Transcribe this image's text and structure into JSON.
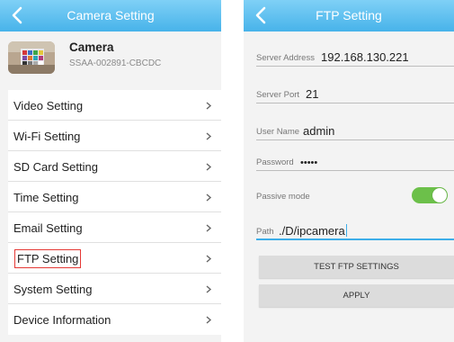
{
  "left": {
    "title": "Camera Setting",
    "camera_name": "Camera",
    "camera_id": "SSAA-002891-CBCDC",
    "menu": [
      {
        "label": "Video Setting"
      },
      {
        "label": "Wi-Fi Setting"
      },
      {
        "label": "SD Card Setting"
      },
      {
        "label": "Time Setting"
      },
      {
        "label": "Email Setting"
      },
      {
        "label": "FTP Setting"
      },
      {
        "label": "System Setting"
      },
      {
        "label": "Device Information"
      }
    ]
  },
  "right": {
    "title": "FTP Setting",
    "server_address": {
      "label": "Server Address",
      "value": "192.168.130.221"
    },
    "server_port": {
      "label": "Server Port",
      "value": "21"
    },
    "user_name": {
      "label": "User Name",
      "value": "admin"
    },
    "password": {
      "label": "Password",
      "value": "•••••"
    },
    "passive_mode": {
      "label": "Passive mode",
      "enabled": true
    },
    "path": {
      "label": "Path",
      "value": "./D/ipcamera"
    },
    "test_button": "TEST FTP SETTINGS",
    "apply_button": "APPLY"
  },
  "colors": {
    "header": "#47b3ea",
    "toggle_on": "#6cc04a",
    "highlight_box": "#e53935",
    "active_underline": "#3daee9"
  },
  "icons": [
    "back-arrow-icon",
    "chevron-right-icon",
    "camera-thumbnail"
  ]
}
